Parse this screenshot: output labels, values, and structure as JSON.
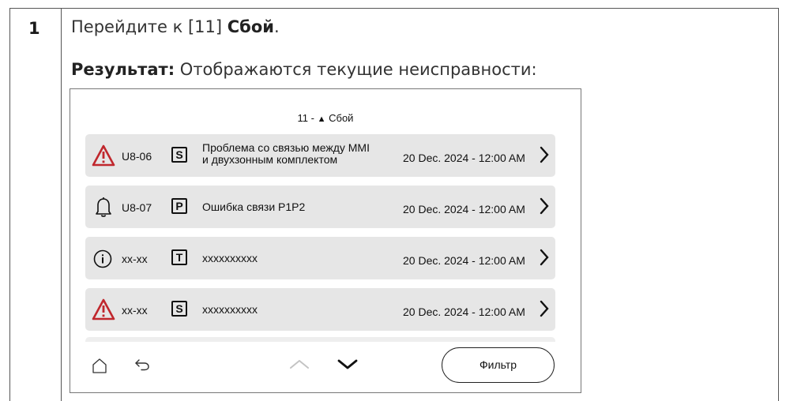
{
  "step": {
    "number": "1",
    "text_before": "Перейдите к [11] ",
    "text_bold": "Сбой",
    "text_after": "."
  },
  "result": {
    "label": "Результат:",
    "text": " Отображаются текущие неисправности:"
  },
  "screen": {
    "title_prefix": "11 - ",
    "title_icon": "▲",
    "title_text": " Сбой",
    "rows": [
      {
        "icon": "warning-triangle-red",
        "code": "U8-06",
        "badge": "S",
        "message_line1": "Проблема со связью между MMI",
        "message_line2": "и двухзонным комплектом",
        "date": "20 Dec. 2024 - 12:00 AM"
      },
      {
        "icon": "bell",
        "code": "U8-07",
        "badge": "P",
        "message_line1": "Ошибка связи P1P2",
        "message_line2": "",
        "date": "20 Dec. 2024 - 12:00 AM"
      },
      {
        "icon": "info-circle",
        "code": "xx-xx",
        "badge": "T",
        "message_line1": "xxxxxxxxxx",
        "message_line2": "",
        "date": "20 Dec. 2024 - 12:00 AM"
      },
      {
        "icon": "warning-triangle-red",
        "code": "xx-xx",
        "badge": "S",
        "message_line1": "xxxxxxxxxx",
        "message_line2": "",
        "date": "20 Dec. 2024 - 12:00 AM"
      }
    ],
    "nav": {
      "home_icon": "home-icon",
      "back_icon": "back-arrow-icon",
      "up_icon": "chevron-up-icon",
      "down_icon": "chevron-down-icon",
      "filter_label": "Фильтр"
    },
    "colors": {
      "warning_red": "#c0272d",
      "row_bg": "#e6e6e6"
    }
  }
}
